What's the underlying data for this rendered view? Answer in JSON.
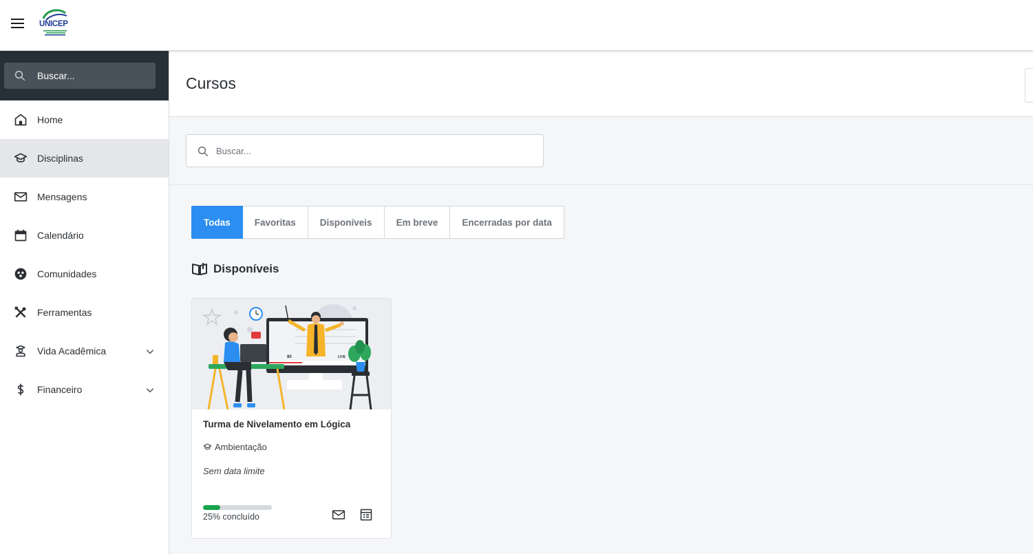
{
  "topbar": {
    "logo_text": "UNICEP",
    "logo_icon": "unicep-logo",
    "menu_icon": "hamburger-menu-icon"
  },
  "sidebar": {
    "search_placeholder": "Buscar...",
    "items": [
      {
        "label": "Home",
        "icon": "home-icon",
        "active": false
      },
      {
        "label": "Disciplinas",
        "icon": "graduation-cap-icon",
        "active": true
      },
      {
        "label": "Mensagens",
        "icon": "mail-icon",
        "active": false
      },
      {
        "label": "Calendário",
        "icon": "calendar-icon",
        "active": false
      },
      {
        "label": "Comunidades",
        "icon": "community-icon",
        "active": false
      },
      {
        "label": "Ferramentas",
        "icon": "tools-icon",
        "active": false
      },
      {
        "label": "Vida Acadêmica",
        "icon": "student-icon",
        "active": false,
        "expandable": true
      },
      {
        "label": "Financeiro",
        "icon": "dollar-icon",
        "active": false,
        "expandable": true
      }
    ]
  },
  "main": {
    "title": "Cursos",
    "search_placeholder": "Buscar...",
    "tabs": [
      {
        "label": "Todas",
        "active": true
      },
      {
        "label": "Favoritas",
        "active": false
      },
      {
        "label": "Disponíveis",
        "active": false
      },
      {
        "label": "Em breve",
        "active": false
      },
      {
        "label": "Encerradas por data",
        "active": false
      }
    ],
    "section_title": "Disponíveis",
    "section_icon": "open-book-icon"
  },
  "course_card": {
    "title": "Turma de Nivelamento em Lógica",
    "category": "Ambientação",
    "category_icon": "graduation-cap-icon",
    "deadline": "Sem data limite",
    "progress": 0.25,
    "progress_label": "25% concluído",
    "live_viewers": "80",
    "live_label": "LIVE"
  },
  "colors": {
    "accent": "#2b8ef0",
    "sidebar_dark": "#273038",
    "progress": "#17a34a",
    "logo_blue": "#1f3e93",
    "logo_green": "#1e9a4a"
  }
}
